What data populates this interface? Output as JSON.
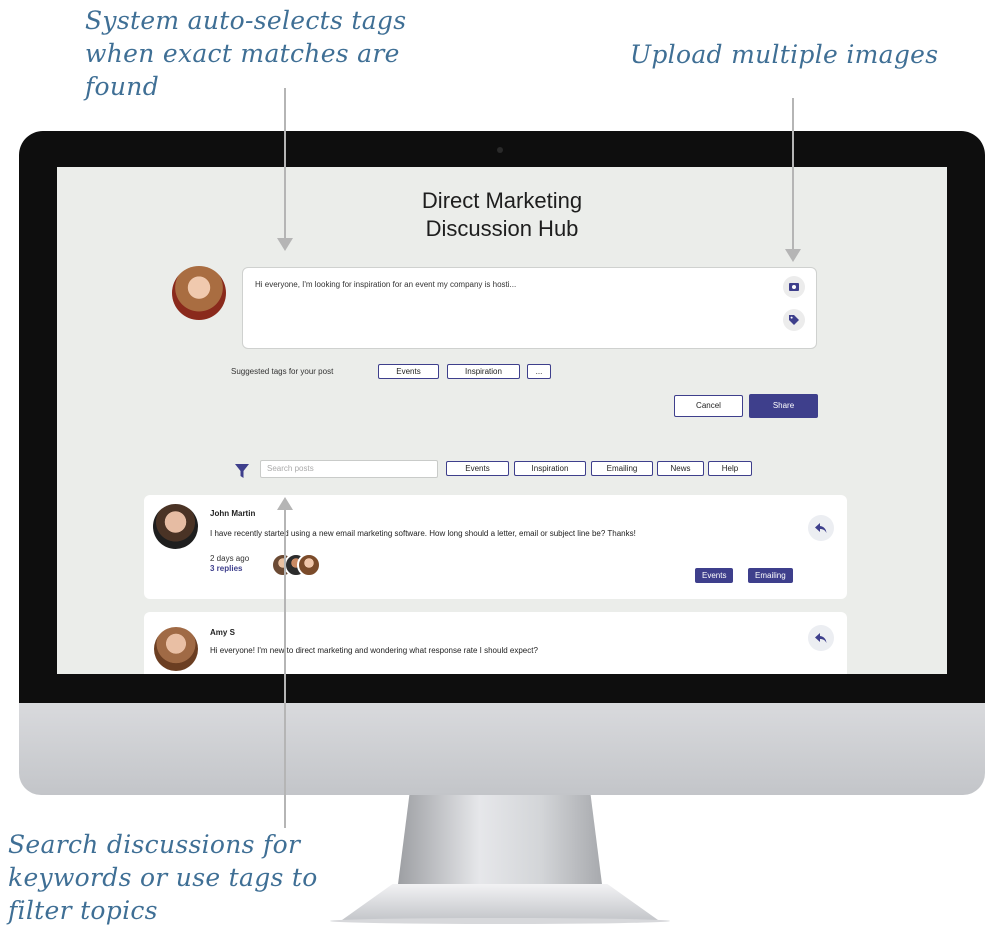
{
  "annotations": {
    "auto_tags": "System auto-selects tags when exact matches are found",
    "upload": "Upload multiple images",
    "search": "Search discussions for keywords or use tags to filter topics"
  },
  "app": {
    "title_line1": "Direct Marketing",
    "title_line2": "Discussion Hub"
  },
  "composer": {
    "text": "Hi everyone, I'm looking for inspiration for an event my company is hosti..."
  },
  "suggested_tags": {
    "label": "Suggested tags for your post",
    "tags": [
      "Events",
      "Inspiration",
      "..."
    ]
  },
  "actions": {
    "cancel": "Cancel",
    "share": "Share"
  },
  "filter": {
    "search_placeholder": "Search posts",
    "tags": [
      "Events",
      "Inspiration",
      "Emailing",
      "News",
      "Help"
    ]
  },
  "posts": [
    {
      "author": "John Martin",
      "text": "I have recently started using a new email marketing software. How long should a letter, email or subject line be? Thanks!",
      "time": "2 days ago",
      "replies": "3 replies",
      "tags": [
        "Events",
        "Emailing"
      ]
    },
    {
      "author": "Amy S",
      "text": "Hi everyone! I'm new to direct marketing and wondering what response rate I should expect?"
    }
  ],
  "colors": {
    "accent": "#3e3f8c",
    "screen_bg": "#ebedea",
    "annotation": "#3f6f95"
  }
}
